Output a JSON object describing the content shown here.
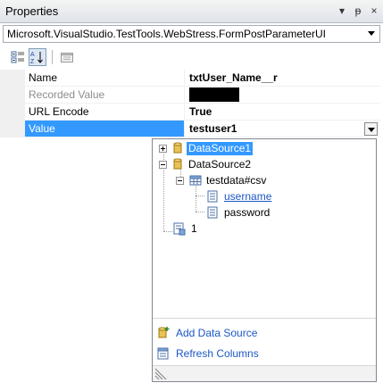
{
  "window": {
    "title": "Properties",
    "controls": {
      "dropdown": "▾",
      "pin": "ᵽ",
      "close": "×"
    }
  },
  "object_selector": {
    "value": "Microsoft.VisualStudio.TestTools.WebStress.FormPostParameterUI"
  },
  "toolbar": {
    "buttons": [
      {
        "icon": "categorized-icon",
        "pressed": false
      },
      {
        "icon": "alphabetical-icon",
        "pressed": true
      },
      {
        "icon": "property-pages-icon",
        "pressed": false
      }
    ]
  },
  "properties": [
    {
      "name": "Name",
      "value": "txtUser_Name__r",
      "disabled": false,
      "selected": false
    },
    {
      "name": "Recorded Value",
      "value": "",
      "redacted": true,
      "disabled": true,
      "selected": false
    },
    {
      "name": "URL Encode",
      "value": "True",
      "disabled": false,
      "selected": false
    },
    {
      "name": "Value",
      "value": "testuser1",
      "disabled": false,
      "selected": true
    }
  ],
  "tree": {
    "nodes": [
      {
        "label": "DataSource1",
        "icon": "database-icon",
        "expander": "+",
        "selected": true
      },
      {
        "label": "DataSource2",
        "icon": "database-icon",
        "expander": "-"
      },
      {
        "label": "testdata#csv",
        "icon": "table-icon",
        "expander": "-"
      },
      {
        "label": "username",
        "icon": "column-icon",
        "link": true
      },
      {
        "label": "password",
        "icon": "column-icon"
      },
      {
        "label": "1",
        "icon": "data-context-icon"
      }
    ]
  },
  "actions": {
    "add_data_source": "Add Data Source",
    "refresh_columns": "Refresh Columns"
  },
  "colors": {
    "selection": "#3399ff",
    "link": "#1c57c4",
    "gutter": "#f0f0f0"
  }
}
